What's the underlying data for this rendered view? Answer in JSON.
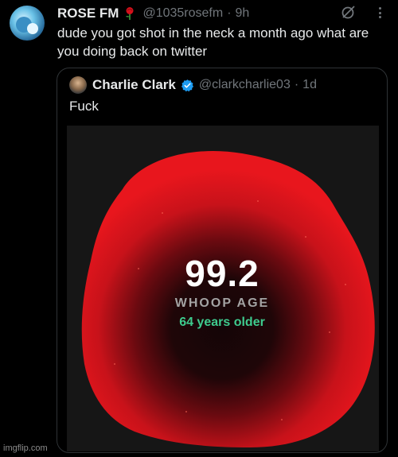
{
  "tweet": {
    "display_name": "ROSE FM",
    "name_emoji": "rose-icon",
    "handle": "@1035rosefm",
    "separator": "·",
    "time": "9h",
    "text": "dude you got shot in the neck a month ago what are you doing back on twitter"
  },
  "quoted_tweet": {
    "display_name": "Charlie Clark",
    "badge": "verified-icon",
    "handle": "@clarkcharlie03",
    "separator": "·",
    "time": "1d",
    "text": "Fuck"
  },
  "whoop_card": {
    "age_value": "99.2",
    "age_label": "WHOOP AGE",
    "age_difference": "64 years older",
    "colors": {
      "blob": "#e3141a",
      "difference_text": "#3ecb8e",
      "background": "#161616"
    }
  },
  "watermark": "imgflip.com",
  "icons": [
    "rose-icon",
    "grok-icon",
    "more-icon",
    "verified-icon"
  ]
}
